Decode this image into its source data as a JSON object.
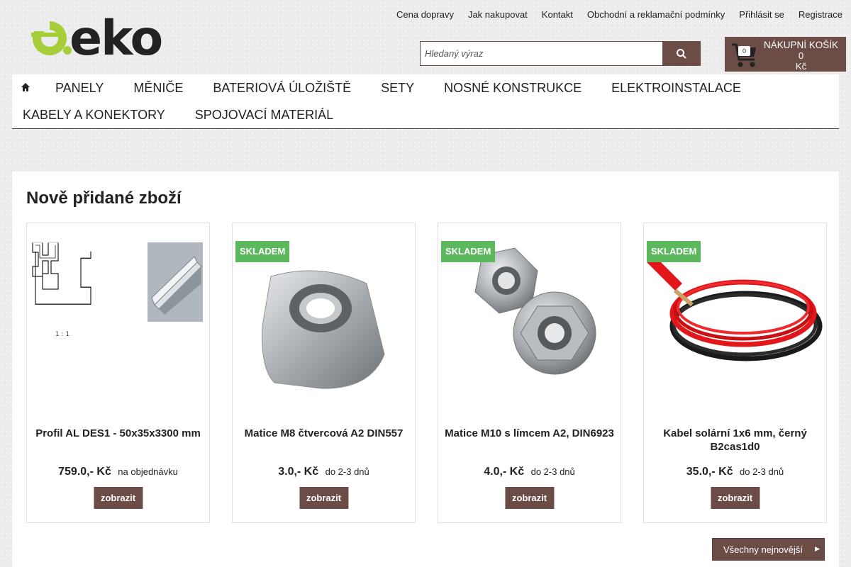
{
  "logo": {
    "text": "eko"
  },
  "top_links": [
    "Cena dopravy",
    "Jak nakupovat",
    "Kontakt",
    "Obchodní a reklamační podmínky",
    "Přihlásit se",
    "Registrace"
  ],
  "search": {
    "placeholder": "Hledaný výraz",
    "button_icon": "search-icon"
  },
  "cart": {
    "label": "NÁKUPNÍ KOŠÍK",
    "count": "0",
    "amount": "0",
    "currency": "Kč",
    "icon": "cart-icon"
  },
  "nav": {
    "home_icon": "home-icon",
    "row1": [
      "PANELY",
      "MĚNIČE",
      "BATERIOVÁ ÚLOŽIŠTĚ",
      "SETY",
      "NOSNÉ KONSTRUKCE",
      "ELEKTROINSTALACE"
    ],
    "row2": [
      "KABELY A KONEKTORY",
      "SPOJOVACÍ MATERIÁL"
    ]
  },
  "main": {
    "title": "Nově přidané zboží",
    "products": [
      {
        "name": "Profil AL DES1 - 50x35x3300 mm",
        "price": "759.0,- Kč",
        "availability": "na objednávku",
        "badge": "",
        "button": "zobrazit",
        "image_label": "1 : 1"
      },
      {
        "name": "Matice M8 čtvercová A2 DIN557",
        "price": "3.0,- Kč",
        "availability": "do 2-3 dnů",
        "badge": "SKLADEM",
        "button": "zobrazit"
      },
      {
        "name": "Matice M10 s límcem A2, DIN6923",
        "price": "4.0,- Kč",
        "availability": "do 2-3 dnů",
        "badge": "SKLADEM",
        "button": "zobrazit"
      },
      {
        "name": "Kabel solární 1x6 mm, černý B2cas1d0",
        "price": "35.0,- Kč",
        "availability": "do 2-3 dnů",
        "badge": "SKLADEM",
        "button": "zobrazit"
      }
    ],
    "all_newest": "Všechny nejnovější"
  },
  "colors": {
    "brand_brown": "#6b4c46",
    "logo_green": "#a6ce39",
    "badge_green": "#5cb85c"
  }
}
